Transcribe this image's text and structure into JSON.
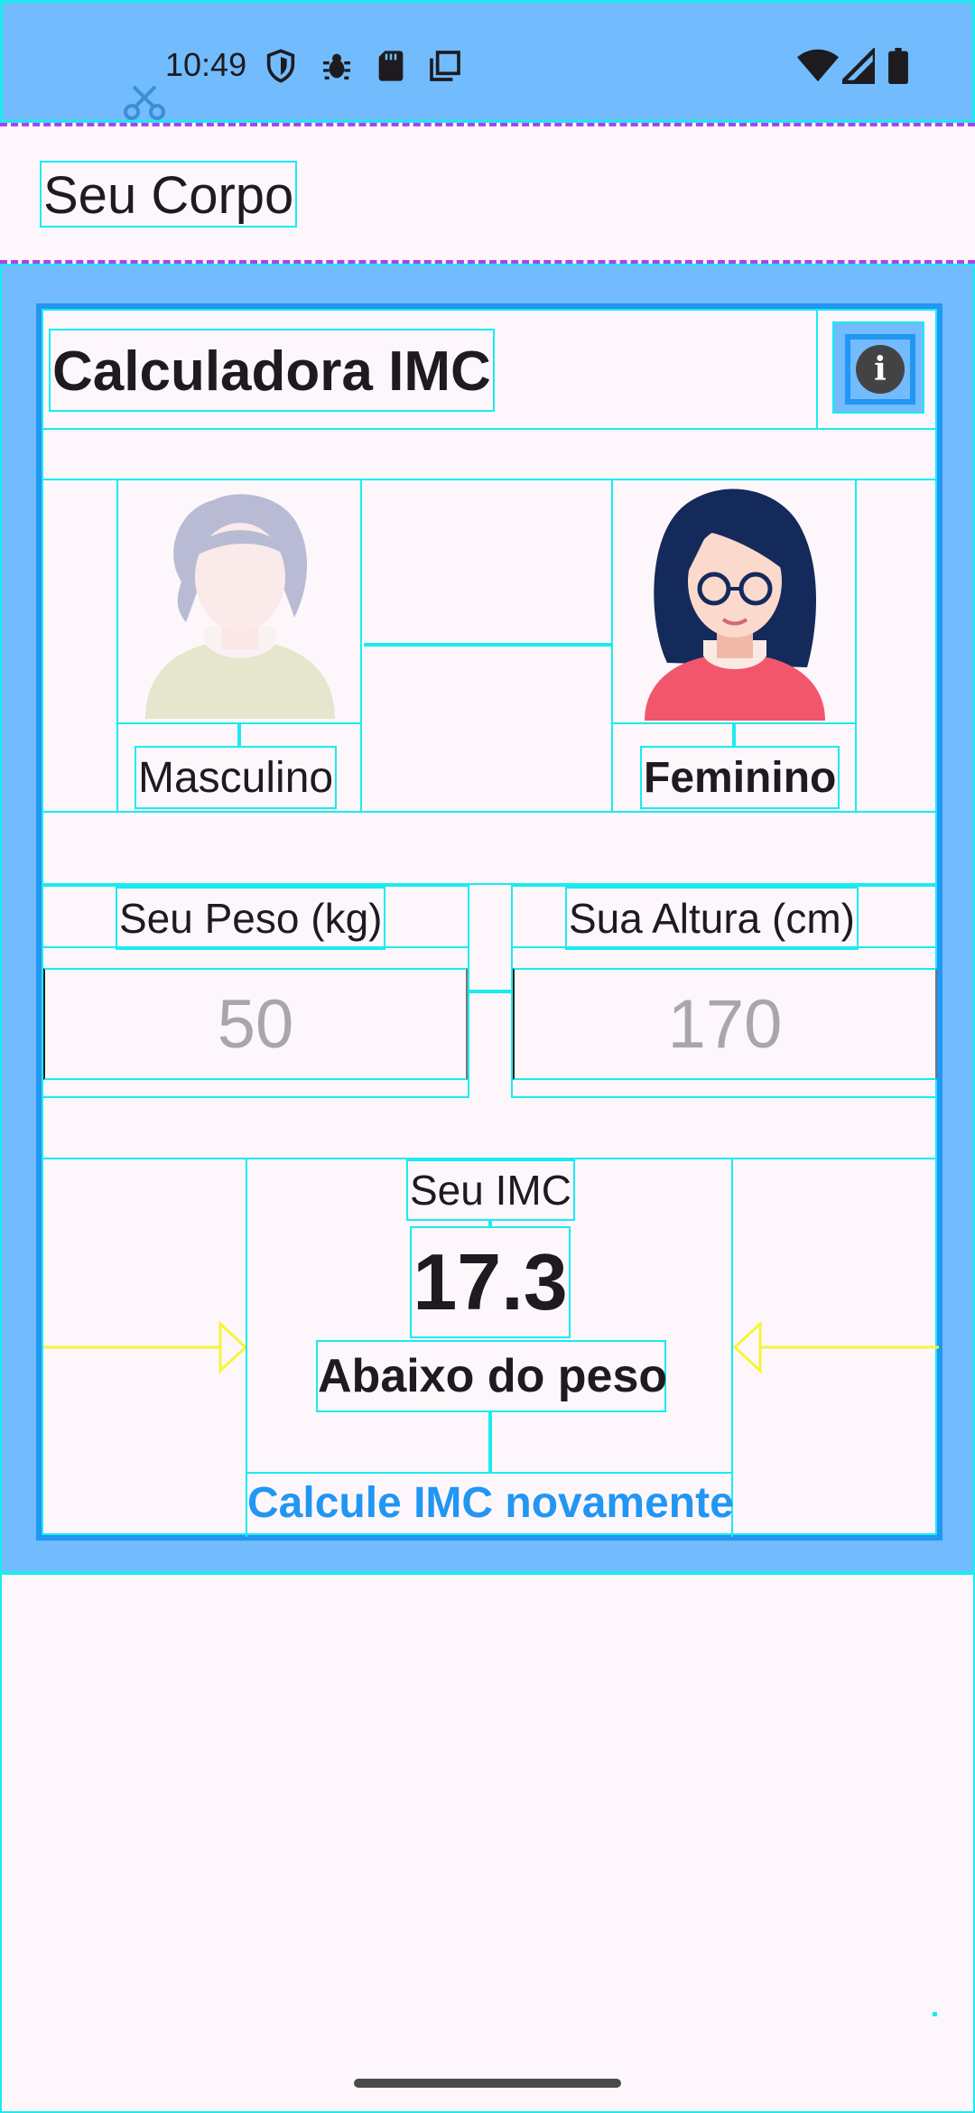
{
  "status_bar": {
    "time": "10:49",
    "icons_left": [
      "shield-icon",
      "bug-icon",
      "sd-card-icon",
      "layers-icon"
    ],
    "icons_right": [
      "wifi-icon",
      "signal-icon",
      "battery-icon"
    ]
  },
  "app_bar": {
    "title": "Seu Corpo"
  },
  "card": {
    "title": "Calculadora IMC",
    "info_icon": "info-icon",
    "genders": [
      {
        "label": "Masculino",
        "selected": false
      },
      {
        "label": "Feminino",
        "selected": true
      }
    ],
    "weight": {
      "label": "Seu Peso (kg)",
      "placeholder": "50"
    },
    "height": {
      "label": "Sua Altura (cm)",
      "placeholder": "170"
    },
    "result": {
      "label": "Seu IMC",
      "value": "17.3",
      "status": "Abaixo do peso",
      "recalc": "Calcule IMC novamente"
    }
  },
  "colors": {
    "primary": "#2196f3",
    "region_blue": "#72bbfd",
    "background": "#fdf7fc"
  }
}
